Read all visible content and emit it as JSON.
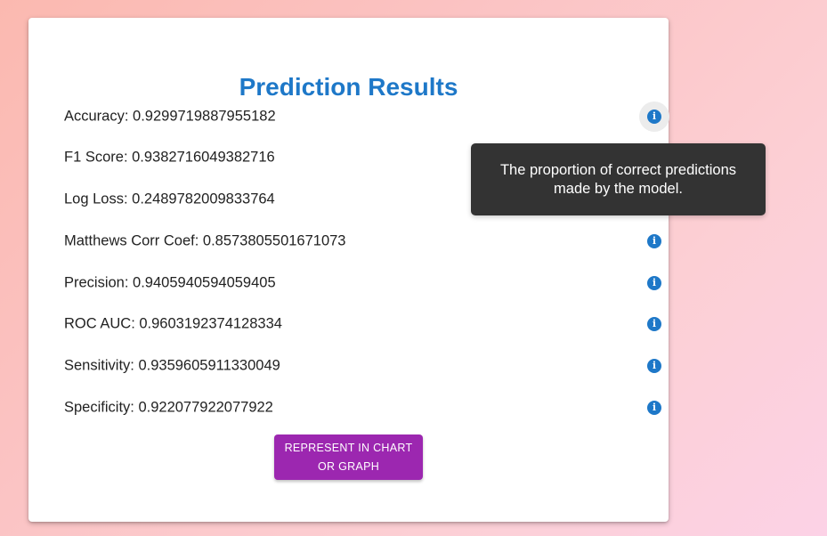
{
  "page": {
    "title": "Prediction Results",
    "colors": {
      "title": "#1e78c8",
      "info_icon": "#1e78c8",
      "button": "#9c27b0",
      "tooltip_bg": "#333333"
    }
  },
  "metrics": [
    {
      "label": "Accuracy",
      "value": "0.9299719887955182",
      "icon": "info-icon"
    },
    {
      "label": "F1 Score",
      "value": "0.9382716049382716",
      "icon": "info-icon"
    },
    {
      "label": "Log Loss",
      "value": "0.2489782009833764",
      "icon": "info-icon"
    },
    {
      "label": "Matthews Corr Coef",
      "value": "0.8573805501671073",
      "icon": "info-icon"
    },
    {
      "label": "Precision",
      "value": "0.9405940594059405",
      "icon": "info-icon"
    },
    {
      "label": "ROC AUC",
      "value": "0.9603192374128334",
      "icon": "info-icon"
    },
    {
      "label": "Sensitivity",
      "value": "0.9359605911330049",
      "icon": "info-icon"
    },
    {
      "label": "Specificity",
      "value": "0.922077922077922",
      "icon": "info-icon"
    }
  ],
  "action_button": {
    "label": "REPRESENT IN CHART OR GRAPH"
  },
  "tooltip": {
    "text": "The proportion of correct predictions made by the model."
  }
}
